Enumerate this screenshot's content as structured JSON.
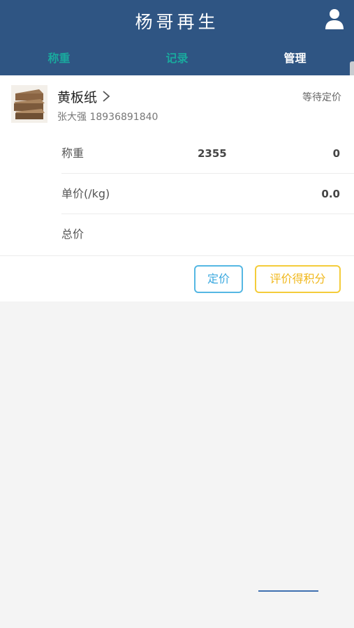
{
  "header": {
    "title": "杨哥再生",
    "user_icon": "user-icon",
    "background": "#2f5583"
  },
  "tabs": [
    {
      "label": "称重",
      "active": false
    },
    {
      "label": "记录",
      "active": false
    },
    {
      "label": "管理",
      "active": true
    }
  ],
  "item": {
    "thumbnail_icon": "cardboard-stack-thumbnail",
    "name": "黄板纸",
    "status": "等待定价",
    "customer": "张大强 18936891840",
    "rows": [
      {
        "label": "称重",
        "value": "2355",
        "value_right": "0"
      },
      {
        "label": "单价(/kg)",
        "value_right": "0.0"
      },
      {
        "label": "总价"
      }
    ]
  },
  "actions": {
    "set_price_label": "定价",
    "rate_label": "评价得积分"
  },
  "colors": {
    "tab_inactive": "#1aa99e",
    "price_button": "#3aa8df",
    "rate_button": "#f0b71a"
  }
}
